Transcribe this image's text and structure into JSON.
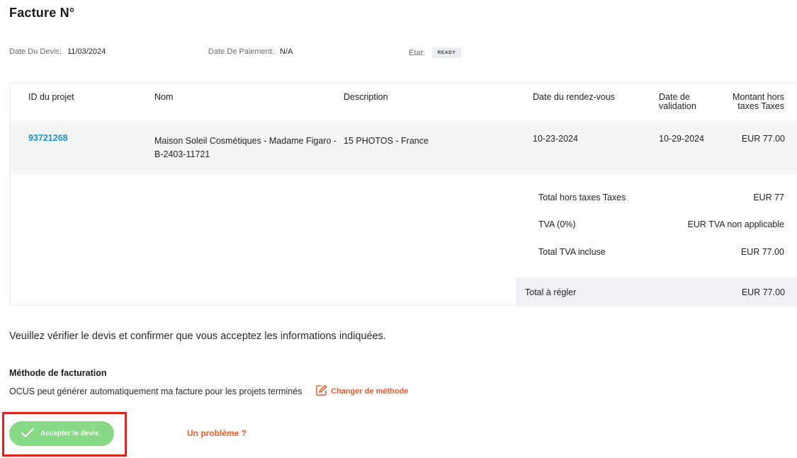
{
  "header": {
    "title": "Facture N°"
  },
  "meta": {
    "devis_label": "Date Du Devis:",
    "devis_value": "11/03/2024",
    "paiement_label": "Date De Paiement:",
    "paiement_value": "N/A",
    "etat_label": "État:",
    "etat_value": "READY"
  },
  "table": {
    "columns": [
      "ID du projet",
      "Nom",
      "Description",
      "Date du rendez-vous",
      "Date de validation",
      "Montant hors taxes Taxes"
    ],
    "rows": [
      {
        "id": "93721268",
        "nom": "Maison Soleil Cosmétiques - Madame Figaro - B-2403-11721",
        "description": "15 PHOTOS - France",
        "date_rdv": "10-23-2024",
        "date_validation": "10-29-2024",
        "montant": "EUR 77.00"
      }
    ]
  },
  "summary": {
    "ht_label": "Total hors taxes Taxes",
    "ht_value": "EUR 77",
    "tva_label": "TVA (0%)",
    "tva_value": "EUR TVA non applicable",
    "ttc_label": "Total TVA incluse",
    "ttc_value": "EUR 77.00",
    "regler_label": "Total à régler",
    "regler_value": "EUR 77.00"
  },
  "verify_text": "Veuillez vérifier le devis et confirmer que vous acceptez les informations indiquées.",
  "billing": {
    "title": "Méthode de facturation",
    "text": "OCUS peut générer automatiquement ma facture pour les projets terminés",
    "change_label": "Changer de méthode"
  },
  "actions": {
    "accept_label": "Accepter le devis",
    "problem_label": "Un problème ?"
  },
  "colors": {
    "accent_orange": "#f15a2b",
    "link_blue": "#1890e0",
    "accept_green": "#88d985",
    "highlight_red": "#e02020"
  }
}
